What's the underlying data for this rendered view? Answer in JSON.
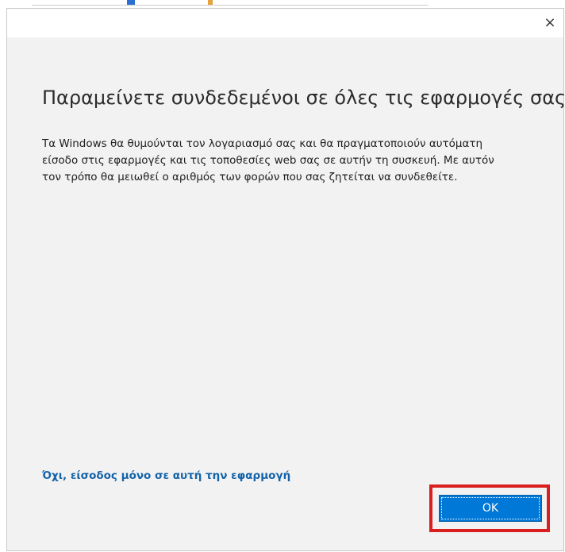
{
  "dialog": {
    "close_glyph": "×",
    "heading": "Παραμείνετε συνδεδεμένοι σε όλες τις εφαρμογές σας",
    "body_line_1": "Τα Windows θα θυμούνται τον λογαριασμό σας και θα πραγματοποιούν αυτόματη",
    "body_line_2": "είσοδο στις εφαρμογές και τις τοποθεσίες web σας σε αυτήν τη συσκευή. Με αυτόν",
    "body_line_3": "τον τρόπο θα μειωθεί ο αριθμός των φορών που σας ζητείται να συνδεθείτε.",
    "alt_link": "Όχι, είσοδος μόνο σε αυτή την εφαρμογή",
    "ok_label": "OK"
  },
  "colors": {
    "accent": "#0078d7",
    "link": "#1463a8",
    "highlight": "#d9201f",
    "dialog_bg": "#f2f2f2"
  },
  "icons": {
    "close": "close-icon"
  }
}
